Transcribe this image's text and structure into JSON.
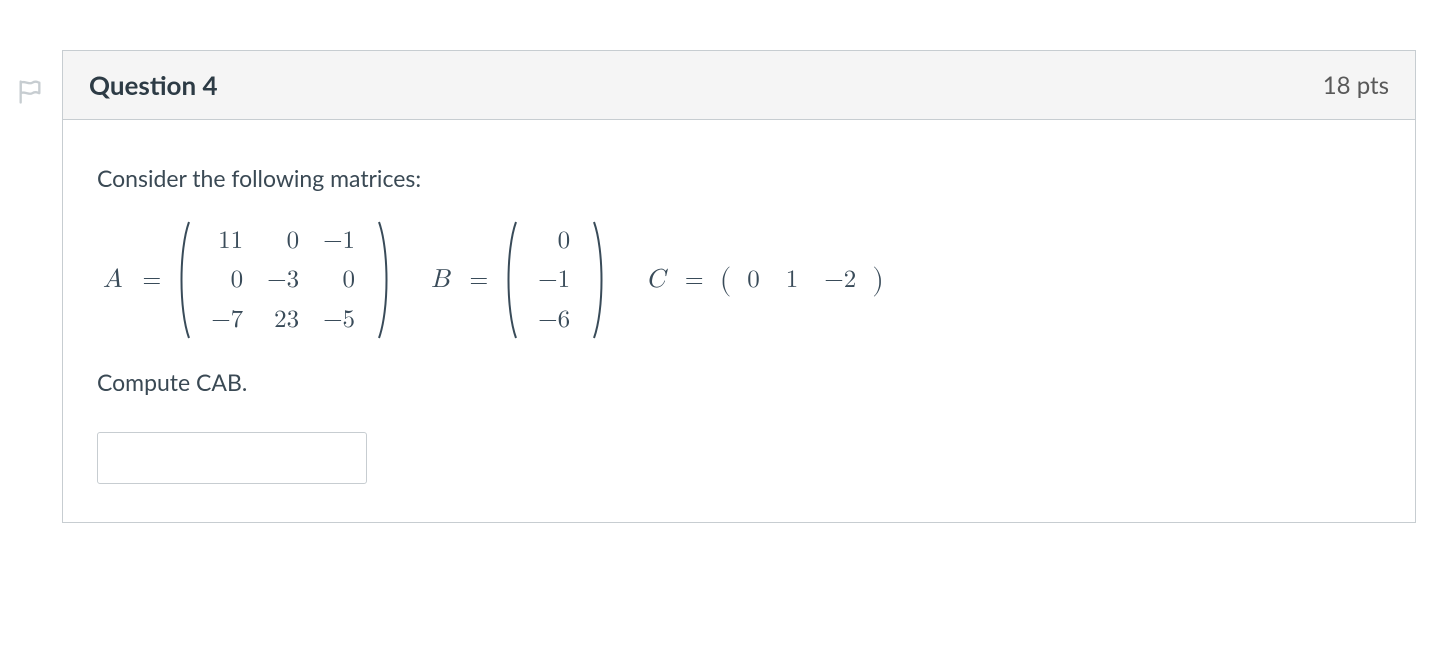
{
  "question": {
    "title": "Question 4",
    "points": "18 pts",
    "prompt": "Consider the following matrices:",
    "computeLine": "Compute CAB.",
    "answerValue": ""
  },
  "matrices": {
    "A": {
      "label": "A",
      "rows": [
        [
          "11",
          "0",
          "−1"
        ],
        [
          "0",
          "−3",
          "0"
        ],
        [
          "−7",
          "23",
          "−5"
        ]
      ]
    },
    "B": {
      "label": "B",
      "rows": [
        [
          "0"
        ],
        [
          "−1"
        ],
        [
          "−6"
        ]
      ]
    },
    "C": {
      "label": "C",
      "cells": [
        "0",
        "1",
        "−2"
      ]
    }
  },
  "icons": {
    "flag": "flag-icon"
  }
}
